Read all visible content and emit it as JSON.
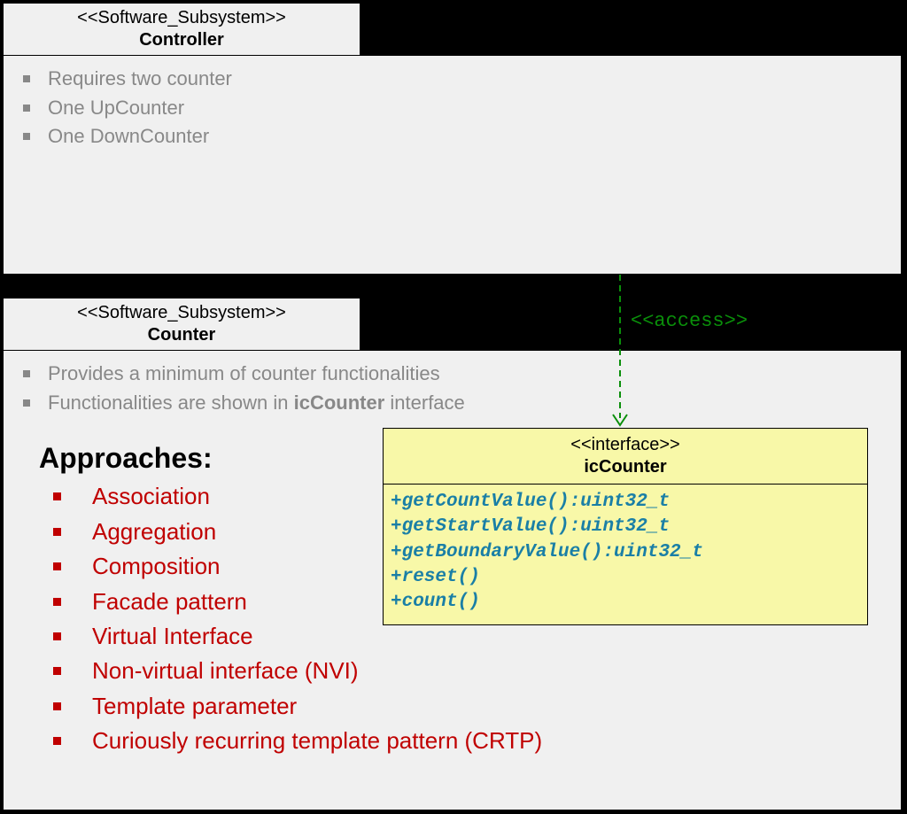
{
  "controller": {
    "stereotype": "<<Software_Subsystem>>",
    "title": "Controller",
    "items": [
      "Requires two counter",
      "One UpCounter",
      "One DownCounter"
    ]
  },
  "counter": {
    "stereotype": "<<Software_Subsystem>>",
    "title": "Counter",
    "items_prefix": "Provides a minimum of counter functionalities",
    "items_line2_a": "Functionalities are shown in ",
    "items_line2_bold": "icCounter",
    "items_line2_b": " interface"
  },
  "approaches": {
    "heading": "Approaches:",
    "items": [
      "Association",
      "Aggregation",
      "Composition",
      "Facade pattern",
      "Virtual Interface",
      "Non-virtual interface (NVI)",
      "Template parameter",
      "Curiously recurring template pattern (CRTP)"
    ]
  },
  "interface": {
    "stereotype": "<<interface>>",
    "title": "icCounter",
    "operations": [
      "+getCountValue():uint32_t",
      "+getStartValue():uint32_t",
      "+getBoundaryValue():uint32_t",
      "+reset()",
      "+count()"
    ]
  },
  "relation": {
    "access_label": "<<access>>"
  }
}
